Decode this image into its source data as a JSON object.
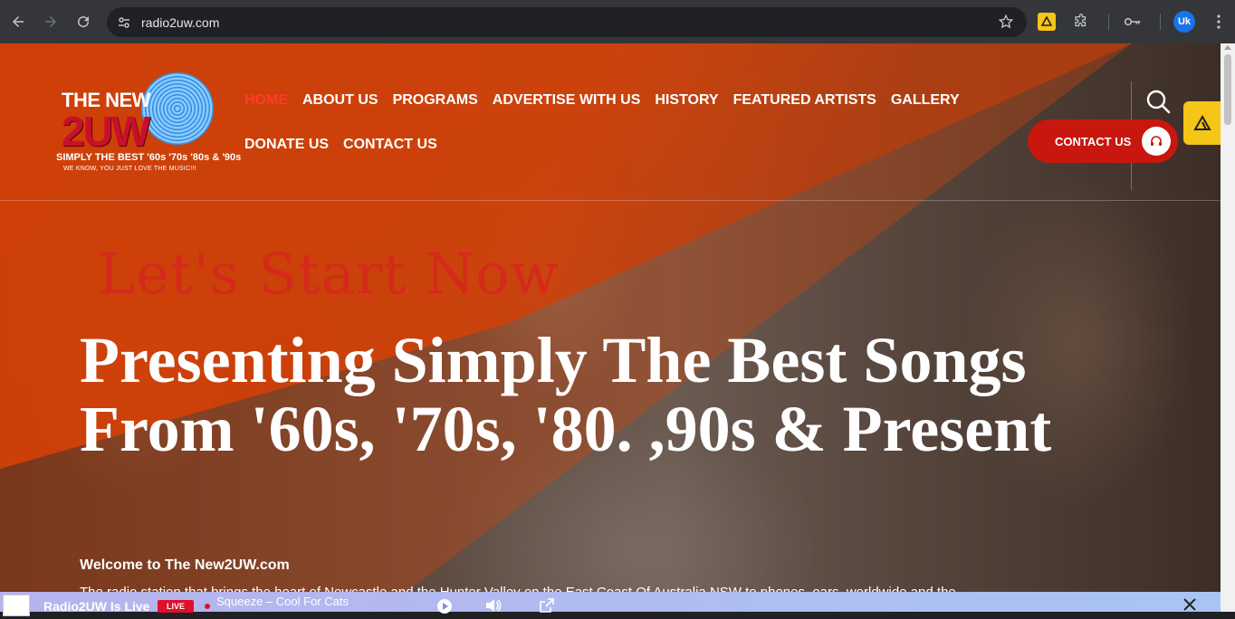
{
  "browser": {
    "url": "radio2uw.com",
    "profile_initials": "Uk",
    "icons": [
      "back-icon",
      "forward-icon",
      "reload-icon",
      "site-info-icon",
      "star-icon",
      "extension-icon",
      "puzzle-icon",
      "key-icon"
    ]
  },
  "logo": {
    "the_new": "THE NEW",
    "uw": "2UW",
    "tagline": "SIMPLY THE BEST '60s '70s '80s & '90s",
    "sub": "WE KNOW, YOU JUST LOVE THE MUSIC!!!"
  },
  "nav": {
    "row1": [
      "HOME",
      "ABOUT US",
      "PROGRAMS",
      "ADVERTISE WITH US",
      "HISTORY",
      "FEATURED ARTISTS",
      "GALLERY"
    ],
    "row2": [
      "DONATE US",
      "CONTACT US"
    ],
    "active": "HOME"
  },
  "contact_button": {
    "label": "CONTACT US"
  },
  "hero": {
    "script": "Let's Start Now",
    "title": "Presenting Simply The Best Songs From '60s, '70s, '80. ,90s & Present",
    "welcome": "Welcome to The New2UW.com",
    "description": "The radio station that brings the heart of Newcastle and the Hunter Valley on the East Coast Of Australia NSW to phones, ears, worldwide and the"
  },
  "player": {
    "title": "Radio2UW Is Live",
    "live_badge": "LIVE",
    "song": "Squeeze – Cool For Cats"
  },
  "colors": {
    "accent_red": "#c8170e",
    "orange_overlay": "#d64006",
    "active_nav": "#ff3b2f"
  }
}
